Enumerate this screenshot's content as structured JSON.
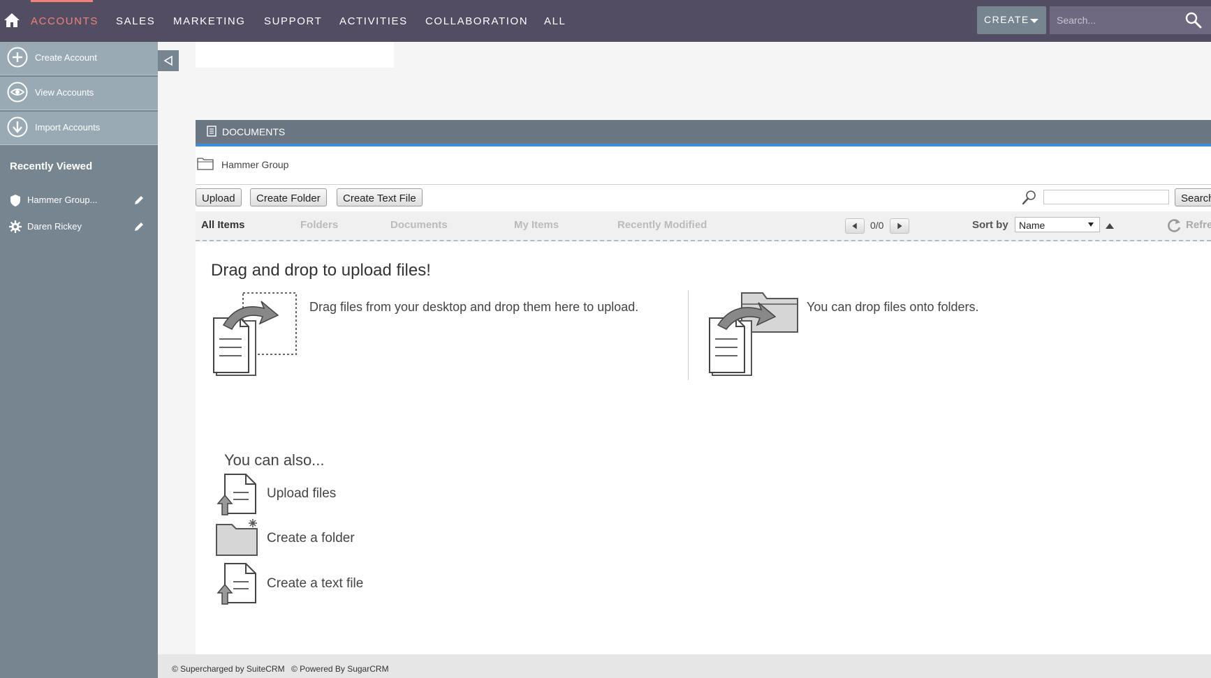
{
  "nav": {
    "items": [
      "ACCOUNTS",
      "SALES",
      "MARKETING",
      "SUPPORT",
      "ACTIVITIES",
      "COLLABORATION",
      "ALL"
    ],
    "active": "ACCOUNTS",
    "create_label": "CREATE",
    "search_placeholder": "Search...",
    "accent_color": "#f08377",
    "bar_color": "#534d64"
  },
  "sidebar": {
    "actions": [
      {
        "label": "Create Account",
        "icon": "plus-circle-icon"
      },
      {
        "label": "View Accounts",
        "icon": "eye-icon"
      },
      {
        "label": "Import Accounts",
        "icon": "download-circle-icon"
      }
    ],
    "recent_title": "Recently Viewed",
    "recent": [
      {
        "label": "Hammer Group...",
        "icon": "shield-icon"
      },
      {
        "label": "Daren Rickey",
        "icon": "gear-icon"
      }
    ]
  },
  "documents": {
    "header": "DOCUMENTS",
    "breadcrumb": "Hammer Group",
    "buttons": [
      "Upload",
      "Create Folder",
      "Create Text File"
    ],
    "search_button": "Search",
    "filters": [
      "All Items",
      "Folders",
      "Documents",
      "My Items",
      "Recently Modified"
    ],
    "pager": "0/0",
    "sort_label": "Sort by",
    "sort_value": "Name",
    "refresh_label": "Refresh",
    "dnd_title": "Drag and drop to upload files!",
    "dnd_text1": "Drag files from your desktop and drop them here to upload.",
    "dnd_text2": "You can drop files onto folders.",
    "also_title": "You can also...",
    "also_links": [
      "Upload files",
      "Create a folder",
      "Create a text file"
    ]
  },
  "footer": {
    "left": "© Supercharged by SuiteCRM",
    "right": "© Powered By SugarCRM"
  }
}
